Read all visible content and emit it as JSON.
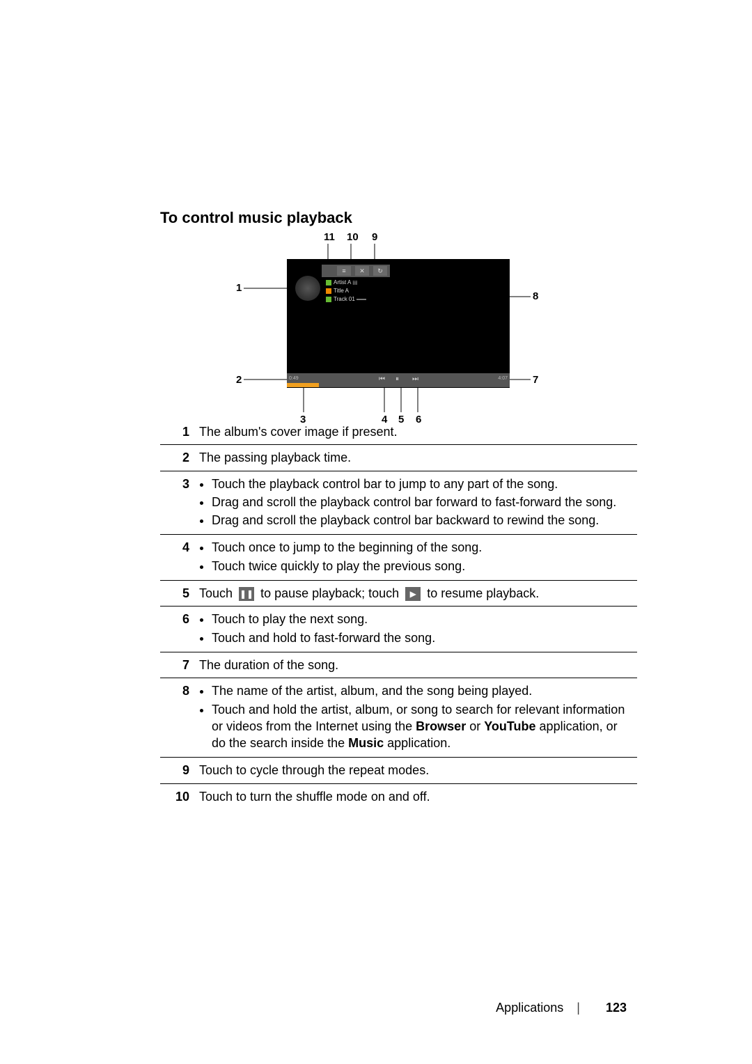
{
  "heading": "To control music playback",
  "callouts": {
    "c1": "1",
    "c2": "2",
    "c3": "3",
    "c4": "4",
    "c5": "5",
    "c6": "6",
    "c7": "7",
    "c8": "8",
    "c9": "9",
    "c10": "10",
    "c11": "11"
  },
  "player": {
    "artist": "Artist A",
    "title": "Title A",
    "track": "Track 01",
    "t_elapsed": "0:49",
    "t_total": "4:07"
  },
  "rows": {
    "r1": "The album's cover image if present.",
    "r2": "The passing playback time.",
    "r3a": "Touch the playback control bar to jump to any part of the song.",
    "r3b": "Drag and scroll the playback control bar forward to fast-forward the song.",
    "r3c": "Drag and scroll the playback control bar backward to rewind the song.",
    "r4a": "Touch once to jump to the beginning of the song.",
    "r4b": "Touch twice quickly to play the previous song.",
    "r5a": "Touch ",
    "r5b": " to pause playback; touch ",
    "r5c": " to resume playback.",
    "r6a": "Touch to play the next song.",
    "r6b": "Touch and hold to fast-forward the song.",
    "r7": "The duration of the song.",
    "r8a": "The name of the artist, album, and the song being played.",
    "r8b_pre": "Touch and hold the artist, album, or song to search for relevant information or videos from the Internet using the ",
    "r8b_bold1": "Browser",
    "r8b_mid": " or ",
    "r8b_bold2": "YouTube",
    "r8b_post": " application, or do the search inside the ",
    "r8b_bold3": "Music",
    "r8b_end": " application.",
    "r9": "Touch to cycle through the repeat modes.",
    "r10": "Touch to turn the shuffle mode on and off."
  },
  "footer": {
    "section": "Applications",
    "page": "123"
  }
}
